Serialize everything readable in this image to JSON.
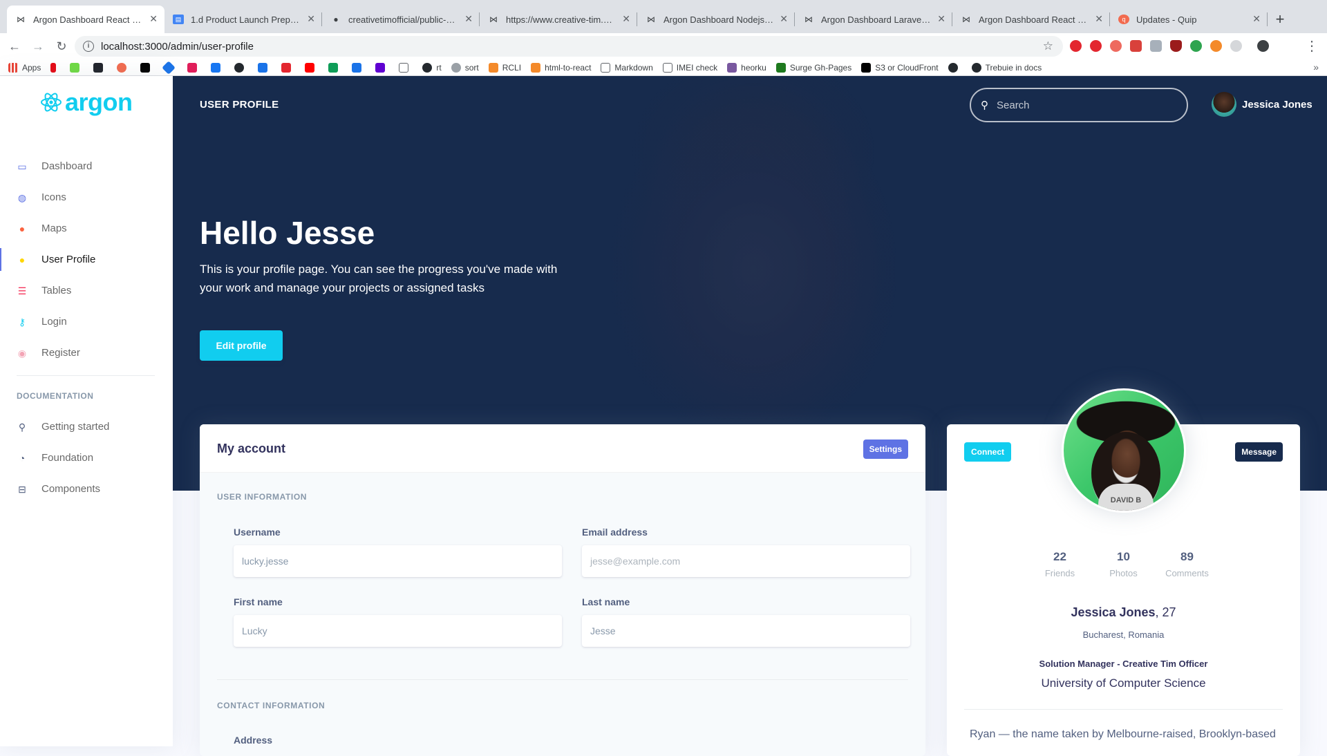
{
  "browser": {
    "tabs": [
      {
        "title": "Argon Dashboard React by C",
        "active": true
      },
      {
        "title": "1.d Product Launch Preparati",
        "active": false
      },
      {
        "title": "creativetimofficial/public-ass",
        "active": false
      },
      {
        "title": "https://www.creative-tim.com",
        "active": false
      },
      {
        "title": "Argon Dashboard Nodejs: Fre",
        "active": false
      },
      {
        "title": "Argon Dashboard Laravel - F",
        "active": false
      },
      {
        "title": "Argon Dashboard React by C",
        "active": false
      },
      {
        "title": "Updates - Quip",
        "active": false
      }
    ],
    "url": "localhost:3000/admin/user-profile",
    "bookmarks": [
      "Apps",
      "rt",
      "sort",
      "RCLI",
      "html-to-react",
      "Markdown",
      "IMEI check",
      "heorku",
      "Surge Gh-Pages",
      "S3 or CloudFront",
      "Trebuie in docs"
    ]
  },
  "sidebar": {
    "brand": "argon",
    "items": [
      {
        "label": "Dashboard",
        "icon": "tv-icon",
        "color": "#5e72e4"
      },
      {
        "label": "Icons",
        "icon": "planet-icon",
        "color": "#5e72e4"
      },
      {
        "label": "Maps",
        "icon": "pin-icon",
        "color": "#fb6340"
      },
      {
        "label": "User Profile",
        "icon": "user-icon",
        "color": "#ffd600"
      },
      {
        "label": "Tables",
        "icon": "bullet-list-icon",
        "color": "#f5365c"
      },
      {
        "label": "Login",
        "icon": "key-icon",
        "color": "#11cdef"
      },
      {
        "label": "Register",
        "icon": "circle-user-icon",
        "color": "#f3a4b5"
      }
    ],
    "doc_heading": "DOCUMENTATION",
    "doc_items": [
      {
        "label": "Getting started",
        "icon": "spaceship-icon"
      },
      {
        "label": "Foundation",
        "icon": "palette-icon"
      },
      {
        "label": "Components",
        "icon": "ui-components-icon"
      }
    ]
  },
  "header": {
    "title": "USER PROFILE",
    "search_placeholder": "Search",
    "user_name": "Jessica Jones",
    "hello": "Hello Jesse",
    "lead": "This is your profile page. You can see the progress you've made with your work and manage your projects or assigned tasks",
    "edit_button": "Edit profile"
  },
  "account": {
    "title": "My account",
    "settings_button": "Settings",
    "user_info_heading": "USER INFORMATION",
    "username_label": "Username",
    "username_value": "lucky.jesse",
    "email_label": "Email address",
    "email_placeholder": "jesse@example.com",
    "first_name_label": "First name",
    "first_name_value": "Lucky",
    "last_name_label": "Last name",
    "last_name_value": "Jesse",
    "contact_heading": "CONTACT INFORMATION",
    "address_label": "Address"
  },
  "profile": {
    "connect_button": "Connect",
    "message_button": "Message",
    "avatar_shirt_text": "DAVID B",
    "stats": [
      {
        "value": "22",
        "label": "Friends"
      },
      {
        "value": "10",
        "label": "Photos"
      },
      {
        "value": "89",
        "label": "Comments"
      }
    ],
    "name": "Jessica Jones",
    "age": ", 27",
    "location": "Bucharest, Romania",
    "job": "Solution Manager - Creative Tim Officer",
    "university": "University of Computer Science",
    "bio": "Ryan — the name taken by Melbourne-raised, Brooklyn-based"
  },
  "colors": {
    "primary": "#5e72e4",
    "info": "#11cdef",
    "default": "#172b4d"
  }
}
